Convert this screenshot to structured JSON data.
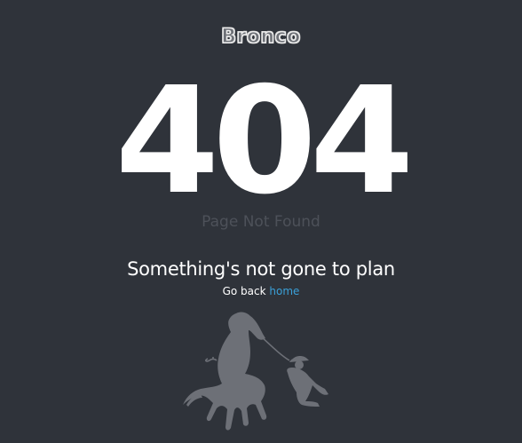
{
  "header": {
    "logo_text": "Bronco"
  },
  "error": {
    "code": "404",
    "subtitle": "Page Not Found"
  },
  "message": {
    "headline": "Something's not gone to plan",
    "go_back_prefix": "Go back",
    "home_link": "home"
  },
  "illustration": {
    "icon": "horse-and-cowboy-icon"
  },
  "colors": {
    "background": "#2f333a",
    "accent_link": "#3aa0d8",
    "muted_text": "#4d5159",
    "silhouette": "#6d7077"
  }
}
